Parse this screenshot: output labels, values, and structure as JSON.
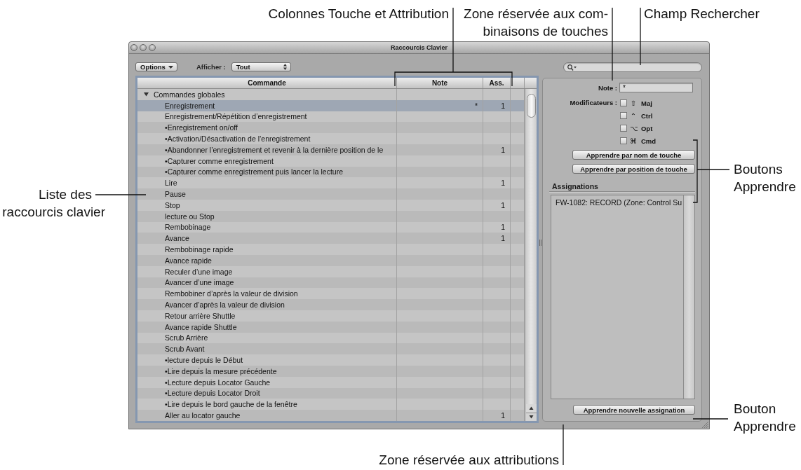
{
  "callouts": [
    {
      "lines": [
        "Colonnes Touche et Attribution"
      ]
    },
    {
      "lines": [
        "Zone réservée aux com-",
        "binaisons de touches"
      ]
    },
    {
      "lines": [
        "Champ Rechercher"
      ]
    },
    {
      "lines": [
        "Liste des",
        "raccourcis clavier"
      ]
    },
    {
      "lines": [
        "Boutons",
        "Apprendre"
      ]
    },
    {
      "lines": [
        "Bouton",
        "Apprendre"
      ]
    },
    {
      "lines": [
        "Zone réservée aux attributions"
      ]
    }
  ],
  "window": {
    "title": "Raccourcis Clavier"
  },
  "toolbar": {
    "options_menu": "Options",
    "show_label": "Afficher :",
    "show_menu": "Tout"
  },
  "table": {
    "columns": [
      "Commande",
      "Note",
      "Ass."
    ],
    "rows": [
      {
        "command": "Commandes globales",
        "expanded": true,
        "selected": false,
        "children": [
          {
            "command": "Enregistrement",
            "note": "*",
            "assignments": "1",
            "selected": true
          },
          {
            "command": "Enregistrement/Répétition d’enregistrement",
            "selected": false
          },
          {
            "command": "•Enregistrement on/off",
            "selected": false
          },
          {
            "command": "•Activation/Désactivation de l’enregistrement",
            "selected": false
          },
          {
            "command": "•Abandonner l’enregistrement et revenir à la dernière position de le",
            "assignments": "1",
            "selected": false
          },
          {
            "command": "•Capturer comme enregistrement",
            "selected": false
          },
          {
            "command": "•Capturer comme enregistrement puis lancer la lecture",
            "selected": false
          },
          {
            "command": "Lire",
            "assignments": "1",
            "selected": false
          },
          {
            "command": "Pause",
            "selected": false
          },
          {
            "command": "Stop",
            "assignments": "1",
            "selected": false
          },
          {
            "command": "lecture ou Stop",
            "selected": false
          },
          {
            "command": "Rembobinage",
            "assignments": "1",
            "selected": false
          },
          {
            "command": "Avance",
            "assignments": "1",
            "selected": false
          },
          {
            "command": "Rembobinage rapide",
            "selected": false
          },
          {
            "command": "Avance rapide",
            "selected": false
          },
          {
            "command": "Reculer d’une image",
            "selected": false
          },
          {
            "command": "Avancer d’une image",
            "selected": false
          },
          {
            "command": "Rembobiner d’après la valeur de division",
            "selected": false
          },
          {
            "command": "Avancer d’après la valeur de division",
            "selected": false
          },
          {
            "command": "Retour arrière Shuttle",
            "selected": false
          },
          {
            "command": "Avance rapide Shuttle",
            "selected": false
          },
          {
            "command": "Scrub Arrière",
            "selected": false
          },
          {
            "command": "Scrub Avant",
            "selected": false
          },
          {
            "command": "•lecture depuis le Début",
            "selected": false
          },
          {
            "command": "•Lire depuis la mesure précédente",
            "selected": false
          },
          {
            "command": "•Lecture depuis Locator Gauche",
            "selected": false
          },
          {
            "command": "•Lecture depuis Locator Droit",
            "selected": false
          },
          {
            "command": "•Lire depuis le bord gauche de la fenêtre",
            "selected": false
          },
          {
            "command": "Aller au locator gauche",
            "assignments": "1",
            "selected": false
          }
        ]
      }
    ]
  },
  "key_panel": {
    "note_label": "Note :",
    "note_value": "*",
    "modifiers_label": "Modificateurs :",
    "modifiers": [
      {
        "symbol": "⇧",
        "label": "Maj",
        "checked": false
      },
      {
        "symbol": "⌃",
        "label": "Ctrl",
        "checked": false
      },
      {
        "symbol": "⌥",
        "label": "Opt",
        "checked": false
      },
      {
        "symbol": "⌘",
        "label": "Cmd",
        "checked": false
      }
    ],
    "learn_buttons": [
      "Apprendre par nom de touche",
      "Apprendre par position de touche"
    ]
  },
  "assignments": {
    "title": "Assignations",
    "items": [
      {
        "text": "FW-1082: RECORD (Zone: Control Su",
        "selected": false
      }
    ],
    "learn_button": "Apprendre nouvelle assignation"
  }
}
